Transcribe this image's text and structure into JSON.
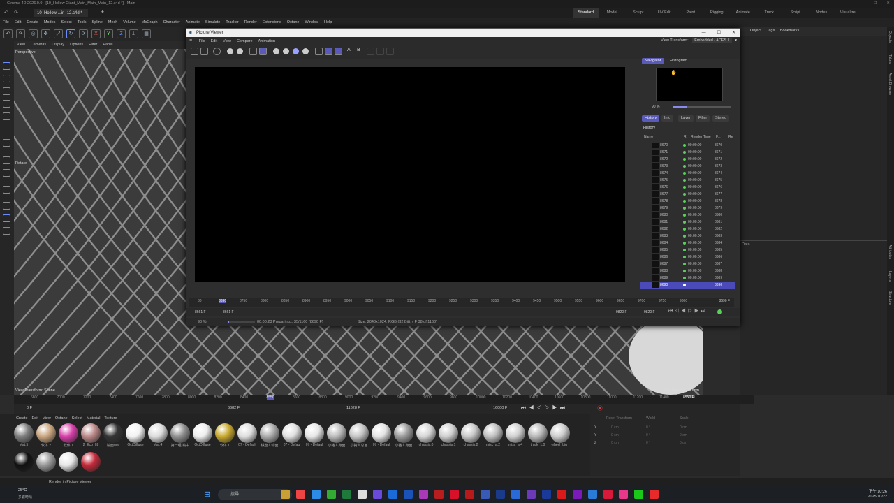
{
  "window": {
    "title": "Cinema 4D 2026.0.0 - [10_Hollow Giant_Main_Main_Main_12.c4d *] - Main",
    "tab": "10_Hollow ...in_12.c4d *"
  },
  "layouts": [
    "Standard",
    "Model",
    "Sculpt",
    "UV Edit",
    "Paint",
    "Rigging",
    "Animate",
    "Track",
    "Script",
    "Nodes",
    "Visualize"
  ],
  "menu": [
    "File",
    "Edit",
    "Create",
    "Modes",
    "Select",
    "Tools",
    "Spline",
    "Mesh",
    "Volume",
    "MoGraph",
    "Character",
    "Animate",
    "Simulate",
    "Tracker",
    "Render",
    "Extensions",
    "Octane",
    "Window",
    "Help"
  ],
  "viewport": {
    "menu": [
      "View",
      "Cameras",
      "Display",
      "Options",
      "Filter",
      "Panel"
    ],
    "label": "Perspective",
    "rotate": "Rotate",
    "transform": "View Transform: Scene",
    "grid": "Grid Spacing : 50 cm"
  },
  "right_panel": {
    "tabs": [
      "Object",
      "Tags",
      "Bookmarks"
    ],
    "vtabs": [
      "Objects",
      "Takes",
      "Asset Browser",
      "Attributes",
      "Layers",
      "Structure"
    ],
    "data": "Data"
  },
  "timeline": {
    "ticks": [
      "6800",
      "7000",
      "7200",
      "7400",
      "7600",
      "7800",
      "8000",
      "8200",
      "8400",
      "8550",
      "8600",
      "8800",
      "9000",
      "9200",
      "9400",
      "9600",
      "9800",
      "10000",
      "10200",
      "10400",
      "10600",
      "10800",
      "11000",
      "11200",
      "11400",
      "11600"
    ],
    "current": "8550 F",
    "start": "0 F",
    "field1": "6682 F",
    "field2": "11628 F",
    "end": "16000 F"
  },
  "materials": {
    "menu": [
      "Create",
      "Edit",
      "View",
      "Octane",
      "Select",
      "Material",
      "Texture"
    ],
    "items": [
      {
        "label": "Mat.5",
        "color": "#7d7d7d"
      },
      {
        "label": "软体.2",
        "color": "#c9a57f"
      },
      {
        "label": "软体.1",
        "color": "#d63fa8"
      },
      {
        "label": "2_Eco_02",
        "color": "#b88"
      },
      {
        "label": "镜面Mat",
        "color": "#333"
      },
      {
        "label": "OctDiffuse",
        "color": "#f2f2f2"
      },
      {
        "label": "Mat.4",
        "color": "#dcdcdc"
      },
      {
        "label": "第一组 镜中",
        "color": "#8f8f8f"
      },
      {
        "label": "OctDiffuse",
        "color": "#eeeeee"
      },
      {
        "label": "软体.1",
        "color": "#c8a82e"
      },
      {
        "label": "07 - Default",
        "color": "#ddd"
      },
      {
        "label": "棋盘人物面",
        "color": "#aaa"
      },
      {
        "label": "07 - Defaul",
        "color": "#e0e0e0"
      },
      {
        "label": "07 - Defaul",
        "color": "#e6e6e6"
      },
      {
        "label": "小猪人身面",
        "color": "#bbb"
      },
      {
        "label": "小猪人总面",
        "color": "#c5c5c5"
      },
      {
        "label": "07 - Defaul",
        "color": "#e3e3e3"
      },
      {
        "label": "小猪人身面",
        "color": "#9a9a9a"
      },
      {
        "label": "chassis.0",
        "color": "#d5d5d5"
      },
      {
        "label": "chassis.1",
        "color": "#cfcfcf"
      },
      {
        "label": "chassis.2",
        "color": "#c8c8c8"
      },
      {
        "label": "misc_a.2",
        "color": "#c0c0c0"
      },
      {
        "label": "misc_a.4",
        "color": "#d0d0d0"
      },
      {
        "label": "track_1.0",
        "color": "#b8b8b8"
      },
      {
        "label": "wheel_big_",
        "color": "#cdcdcd"
      },
      {
        "label": "",
        "color": "#111"
      },
      {
        "label": "",
        "color": "#9a9a9a"
      },
      {
        "label": "",
        "color": "#e8e8e8"
      },
      {
        "label": "",
        "color": "#c42a3a"
      }
    ]
  },
  "coords": {
    "transform": "Reset Transform",
    "world": "World",
    "scale": "Scale",
    "labels": [
      "X",
      "Y",
      "Z"
    ],
    "v1": [
      "0 cm",
      "0 cm",
      "0 cm"
    ],
    "v2": [
      "0 °",
      "0 °",
      "0 °"
    ],
    "v3": [
      "0 cm",
      "0 cm",
      "0 cm"
    ]
  },
  "status": {
    "text": "Render in Picture Viewer"
  },
  "picture_viewer": {
    "title": "Picture Viewer",
    "menu": [
      "File",
      "Edit",
      "View",
      "Compare",
      "Animation"
    ],
    "view_transform": "View Transform:",
    "view_transform_value": "Embedded / ACES 1",
    "navigator_tab": "Navigator",
    "histogram_tab": "Histogram",
    "zoom": "90 %",
    "tabs": [
      "History",
      "Info",
      "Layer",
      "Filter",
      "Stereo"
    ],
    "history_label": "History",
    "columns": [
      "Name",
      "R",
      "Render Time",
      "F...",
      "Re"
    ],
    "rows": [
      {
        "name": "8670",
        "time": "00:00:00",
        "frame": "8670"
      },
      {
        "name": "8671",
        "time": "00:00:00",
        "frame": "8671"
      },
      {
        "name": "8672",
        "time": "00:00:00",
        "frame": "8672"
      },
      {
        "name": "8673",
        "time": "00:00:00",
        "frame": "8673"
      },
      {
        "name": "8674",
        "time": "00:00:00",
        "frame": "8674"
      },
      {
        "name": "8675",
        "time": "00:00:00",
        "frame": "8675"
      },
      {
        "name": "8676",
        "time": "00:00:00",
        "frame": "8676"
      },
      {
        "name": "8677",
        "time": "00:00:00",
        "frame": "8677"
      },
      {
        "name": "8678",
        "time": "00:00:00",
        "frame": "8678"
      },
      {
        "name": "8679",
        "time": "00:00:00",
        "frame": "8679"
      },
      {
        "name": "8680",
        "time": "00:00:00",
        "frame": "8680"
      },
      {
        "name": "8681",
        "time": "00:00:00",
        "frame": "8681"
      },
      {
        "name": "8682",
        "time": "00:00:00",
        "frame": "8682"
      },
      {
        "name": "8683",
        "time": "00:00:00",
        "frame": "8683"
      },
      {
        "name": "8684",
        "time": "00:00:00",
        "frame": "8684"
      },
      {
        "name": "8685",
        "time": "00:00:00",
        "frame": "8685"
      },
      {
        "name": "8686",
        "time": "00:00:00",
        "frame": "8686"
      },
      {
        "name": "8687",
        "time": "00:00:00",
        "frame": "8687"
      },
      {
        "name": "8688",
        "time": "00:00:00",
        "frame": "8688"
      },
      {
        "name": "8689",
        "time": "00:00:00",
        "frame": "8689"
      },
      {
        "name": "8690",
        "time": "",
        "frame": "8690"
      }
    ],
    "timeline_ticks": [
      "30",
      "8690",
      "8750",
      "8800",
      "8850",
      "8900",
      "8950",
      "9000",
      "9050",
      "9100",
      "9150",
      "9200",
      "9250",
      "9300",
      "9350",
      "9400",
      "9450",
      "9500",
      "9550",
      "9600",
      "9650",
      "9700",
      "9750",
      "9800"
    ],
    "timeline_end": "8690 F",
    "frame_start": "8661 F",
    "frame_cur": "8661 F",
    "frame_a": "9820 F",
    "frame_b": "9820 F",
    "status_zoom": "90 %",
    "status_progress": "00:00:23 Preparing... 35/1160 (8690 F)",
    "status_size": "Size: 2048x1024, RGB (32 Bit), ( F 38 of 1160)",
    "progress_fraction": 0.03
  },
  "taskbar": {
    "weather": "25°C",
    "weather_sub": "多雲時晴",
    "search": "搜尋",
    "time": "下午 10:26",
    "date": "2025/10/22"
  }
}
